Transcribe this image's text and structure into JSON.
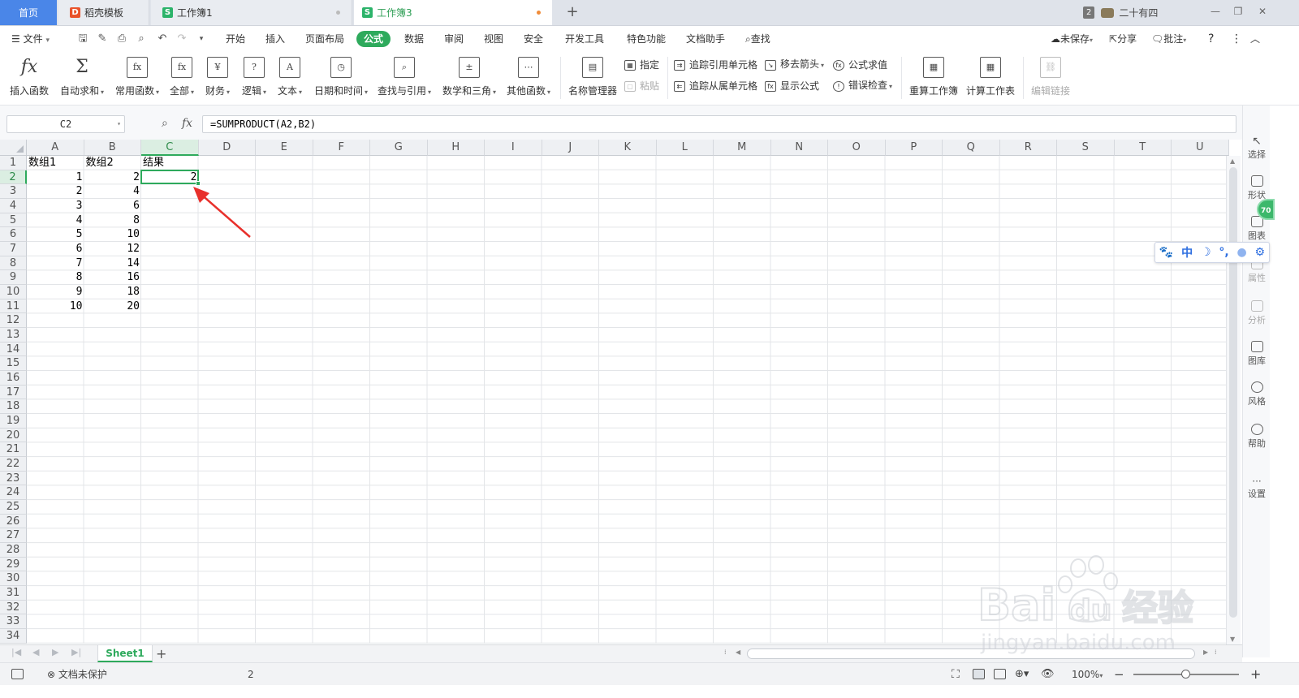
{
  "tabs": {
    "home": "首页",
    "items": [
      {
        "label": "稻壳模板",
        "icon": "D"
      },
      {
        "label": "工作簿1",
        "icon": "S"
      },
      {
        "label": "工作簿3",
        "icon": "S"
      }
    ],
    "window_count": "2",
    "user": "二十有四"
  },
  "menu": {
    "file": "文件",
    "items": [
      "开始",
      "插入",
      "页面布局",
      "公式",
      "数据",
      "审阅",
      "视图",
      "安全",
      "开发工具",
      "特色功能",
      "文档助手"
    ],
    "active": "公式",
    "search": "查找",
    "unsaved": "未保存",
    "share": "分享",
    "comment": "批注"
  },
  "ribbon": {
    "insert_function": "插入函数",
    "autosum": "自动求和",
    "common": "常用函数",
    "all": "全部",
    "finance": "财务",
    "logic": "逻辑",
    "text": "文本",
    "datetime": "日期和时间",
    "lookup": "查找与引用",
    "math": "数学和三角",
    "other": "其他函数",
    "name_manager": "名称管理器",
    "assign": "指定",
    "paste": "粘贴",
    "trace_precedents": "追踪引用单元格",
    "trace_dependents": "追踪从属单元格",
    "remove_arrows": "移去箭头",
    "show_formulas": "显示公式",
    "evaluate": "公式求值",
    "error_check": "错误检查",
    "recalc_workbook": "重算工作簿",
    "calc_sheet": "计算工作表",
    "edit_links": "编辑链接"
  },
  "formula_bar": {
    "name_box": "C2",
    "fx": "fx",
    "formula": "=SUMPRODUCT(A2,B2)"
  },
  "grid": {
    "columns": [
      "A",
      "B",
      "C",
      "D",
      "E",
      "F",
      "G",
      "H",
      "I",
      "J",
      "K",
      "L",
      "M",
      "N",
      "O",
      "P",
      "Q",
      "R",
      "S",
      "T",
      "U"
    ],
    "selected_column": "C",
    "selected_row": 2,
    "row_count": 34,
    "headers": [
      "数组1",
      "数组2",
      "结果"
    ],
    "rows": [
      [
        1,
        2,
        2
      ],
      [
        2,
        4,
        null
      ],
      [
        3,
        6,
        null
      ],
      [
        4,
        8,
        null
      ],
      [
        5,
        10,
        null
      ],
      [
        6,
        12,
        null
      ],
      [
        7,
        14,
        null
      ],
      [
        8,
        16,
        null
      ],
      [
        9,
        18,
        null
      ],
      [
        10,
        20,
        null
      ]
    ]
  },
  "sidebar": {
    "items": [
      "选择",
      "形状",
      "图表",
      "属性",
      "分析",
      "图库",
      "风格",
      "帮助",
      "设置"
    ],
    "badge": "70"
  },
  "ime": {
    "lang": "中"
  },
  "sheets": {
    "tabs": [
      "Sheet1"
    ]
  },
  "status": {
    "protect": "文档未保护",
    "value": "2",
    "zoom": "100%",
    "zoom_level": 0.5
  },
  "watermark": {
    "brand": "Bai",
    "brand2": "du",
    "brand_cn": "经验",
    "url": "jingyan.baidu.com"
  },
  "colors": {
    "accent": "#2eaa5c",
    "home_tab": "#4a86e8",
    "arrow": "#e8302b"
  }
}
